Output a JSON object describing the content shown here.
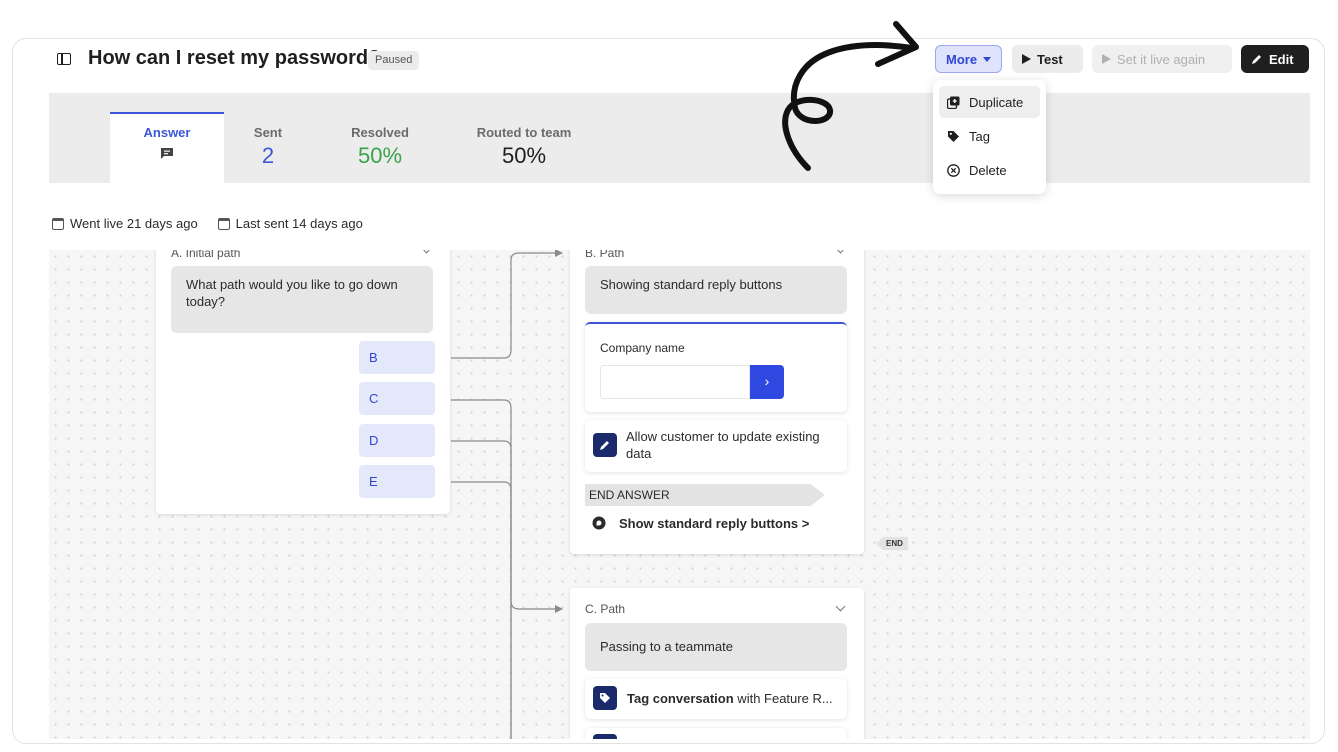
{
  "header": {
    "title": "How can I reset my password?",
    "status_badge": "Paused",
    "more_label": "More",
    "test_label": "Test",
    "live_label": "Set it live again",
    "edit_label": "Edit"
  },
  "more_menu": {
    "items": [
      {
        "label": "Duplicate",
        "icon": "duplicate-icon"
      },
      {
        "label": "Tag",
        "icon": "tag-icon"
      },
      {
        "label": "Delete",
        "icon": "delete-icon"
      }
    ]
  },
  "stats": {
    "answer_label": "Answer",
    "sent_label": "Sent",
    "sent_value": "2",
    "resolved_label": "Resolved",
    "resolved_value": "50%",
    "routed_label": "Routed to team",
    "routed_value": "50%",
    "colors": {
      "sent": "#3d55d9",
      "resolved": "#3aa34a",
      "accent": "#3d55d9"
    }
  },
  "meta": {
    "went_live": "Went live 21 days ago",
    "last_sent": "Last sent 14 days ago"
  },
  "flow": {
    "path_a": {
      "title": "A. Initial path",
      "message": "What path would you like to go down today?",
      "options": [
        "B",
        "C",
        "D",
        "E"
      ]
    },
    "path_b": {
      "title": "B. Path",
      "message": "Showing standard reply buttons",
      "field_label": "Company name",
      "field_value": "",
      "submit_symbol": "›",
      "action_text": "Allow customer to update existing data",
      "end_label": "END ANSWER",
      "reply_buttons": "Show standard reply buttons >",
      "end_tag": "END"
    },
    "path_c": {
      "title": "C. Path",
      "message": "Passing to a teammate",
      "tag_action_bold": "Tag conversation",
      "tag_action_rest": " with Feature R..."
    }
  }
}
